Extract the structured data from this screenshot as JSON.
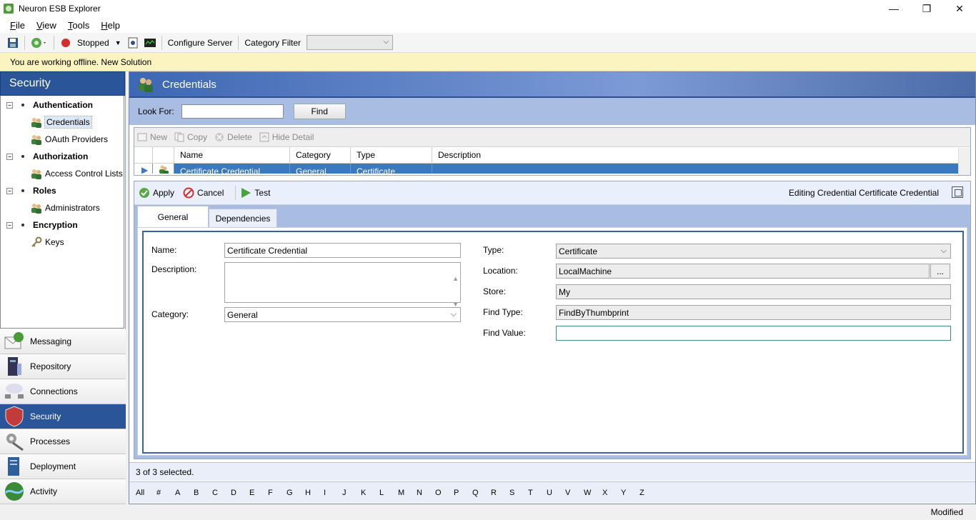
{
  "window": {
    "title": "Neuron ESB Explorer",
    "minimize": "—",
    "maximize": "❐",
    "close": "✕"
  },
  "menu": [
    {
      "label": "File",
      "key": "F",
      "rest": "ile"
    },
    {
      "label": "View",
      "key": "V",
      "rest": "iew"
    },
    {
      "label": "Tools",
      "key": "T",
      "rest": "ools"
    },
    {
      "label": "Help",
      "key": "H",
      "rest": "elp"
    }
  ],
  "toolbar": {
    "status_label": "Stopped",
    "configure_server": "Configure Server",
    "category_filter": "Category Filter",
    "category_filter_value": ""
  },
  "banner": {
    "text": "You are working offline. New Solution"
  },
  "leftnav": {
    "header": "Security",
    "tree": [
      {
        "label": "Authentication",
        "type": "group"
      },
      {
        "label": "Credentials",
        "type": "item",
        "selected": true
      },
      {
        "label": "OAuth Providers",
        "type": "item"
      },
      {
        "label": "Authorization",
        "type": "group"
      },
      {
        "label": "Access Control Lists",
        "type": "item"
      },
      {
        "label": "Roles",
        "type": "group"
      },
      {
        "label": "Administrators",
        "type": "item"
      },
      {
        "label": "Encryption",
        "type": "group"
      },
      {
        "label": "Keys",
        "type": "item"
      }
    ],
    "buttons": [
      "Messaging",
      "Repository",
      "Connections",
      "Security",
      "Processes",
      "Deployment",
      "Activity"
    ],
    "active_button": "Security"
  },
  "main": {
    "header": "Credentials",
    "search": {
      "label": "Look For:",
      "value": "",
      "button": "Find"
    },
    "list_toolbar": {
      "new": "New",
      "copy": "Copy",
      "delete": "Delete",
      "hide_detail": "Hide Detail"
    },
    "columns": [
      "Name",
      "Category",
      "Type",
      "Description"
    ],
    "rows": [
      {
        "name": "Certificate Credential",
        "category": "General",
        "type": "Certificate",
        "description": ""
      }
    ],
    "detail_toolbar": {
      "apply": "Apply",
      "cancel": "Cancel",
      "test": "Test",
      "editing": "Editing Credential Certificate Credential"
    },
    "tabs": {
      "general": "General",
      "dependencies": "Dependencies"
    },
    "form": {
      "name_label": "Name:",
      "name_value": "Certificate Credential",
      "description_label": "Description:",
      "description_value": "",
      "category_label": "Category:",
      "category_value": "General",
      "type_label": "Type:",
      "type_value": "Certificate",
      "location_label": "Location:",
      "location_value": "LocalMachine",
      "location_button": "...",
      "store_label": "Store:",
      "store_value": "My",
      "find_type_label": "Find Type:",
      "find_type_value": "FindByThumbprint",
      "find_value_label": "Find Value:",
      "find_value_value": ""
    },
    "selected_status": "3 of 3 selected.",
    "alphabet": [
      "All",
      "#",
      "A",
      "B",
      "C",
      "D",
      "E",
      "F",
      "G",
      "H",
      "I",
      "J",
      "K",
      "L",
      "M",
      "N",
      "O",
      "P",
      "Q",
      "R",
      "S",
      "T",
      "U",
      "V",
      "W",
      "X",
      "Y",
      "Z"
    ]
  },
  "statusbar": {
    "text": "Modified"
  }
}
